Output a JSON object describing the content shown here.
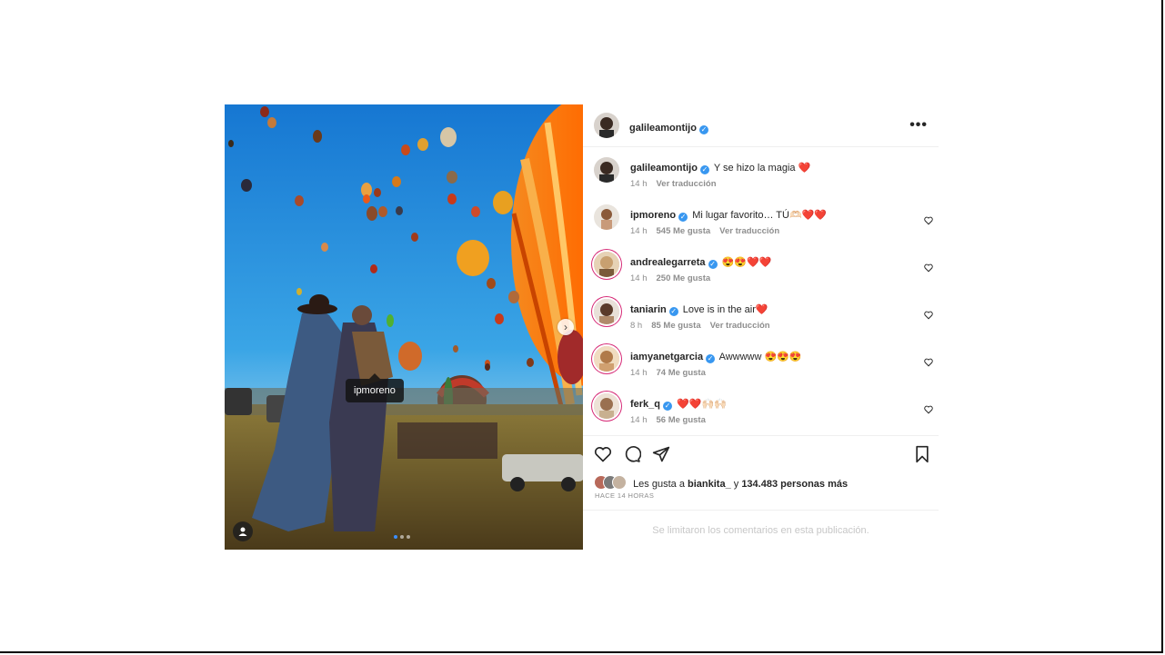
{
  "post": {
    "author": "galileamontijo",
    "more_label": "•••",
    "tag_label": "ipmoreno",
    "next_label": "›",
    "caption": {
      "user": "galileamontijo",
      "text": "Y se hizo la magia ❤️",
      "time": "14 h",
      "translate": "Ver traducción"
    }
  },
  "comments": [
    {
      "user": "ipmoreno",
      "text": "Mi lugar favorito… TÚ🫶🏻❤️❤️",
      "time": "14 h",
      "likes": "545 Me gusta",
      "translate": "Ver traducción"
    },
    {
      "user": "andrealegarreta",
      "text": "😍😍❤️❤️",
      "time": "14 h",
      "likes": "250 Me gusta",
      "translate": ""
    },
    {
      "user": "taniarin",
      "text": "Love is in the air❤️",
      "time": "8 h",
      "likes": "85 Me gusta",
      "translate": "Ver traducción"
    },
    {
      "user": "iamyanetgarcia",
      "text": "Awwwww 😍😍😍",
      "time": "14 h",
      "likes": "74 Me gusta",
      "translate": ""
    },
    {
      "user": "ferk_q",
      "text": "❤️❤️🙌🏻🙌🏻",
      "time": "14 h",
      "likes": "56 Me gusta",
      "translate": ""
    }
  ],
  "likes": {
    "prefix": "Les gusta a",
    "user": "biankita_",
    "connector": "y",
    "others": "134.483 personas más"
  },
  "time_ago": "HACE 14 HORAS",
  "comments_limited": "Se limitaron los comentarios en esta publicación.",
  "colors": {
    "verified": "#3897f0",
    "story_ring": "#d62976",
    "sky_top": "#1677d2",
    "sky_bottom": "#4ab0e6",
    "balloon_orange": "#f07a1a"
  }
}
